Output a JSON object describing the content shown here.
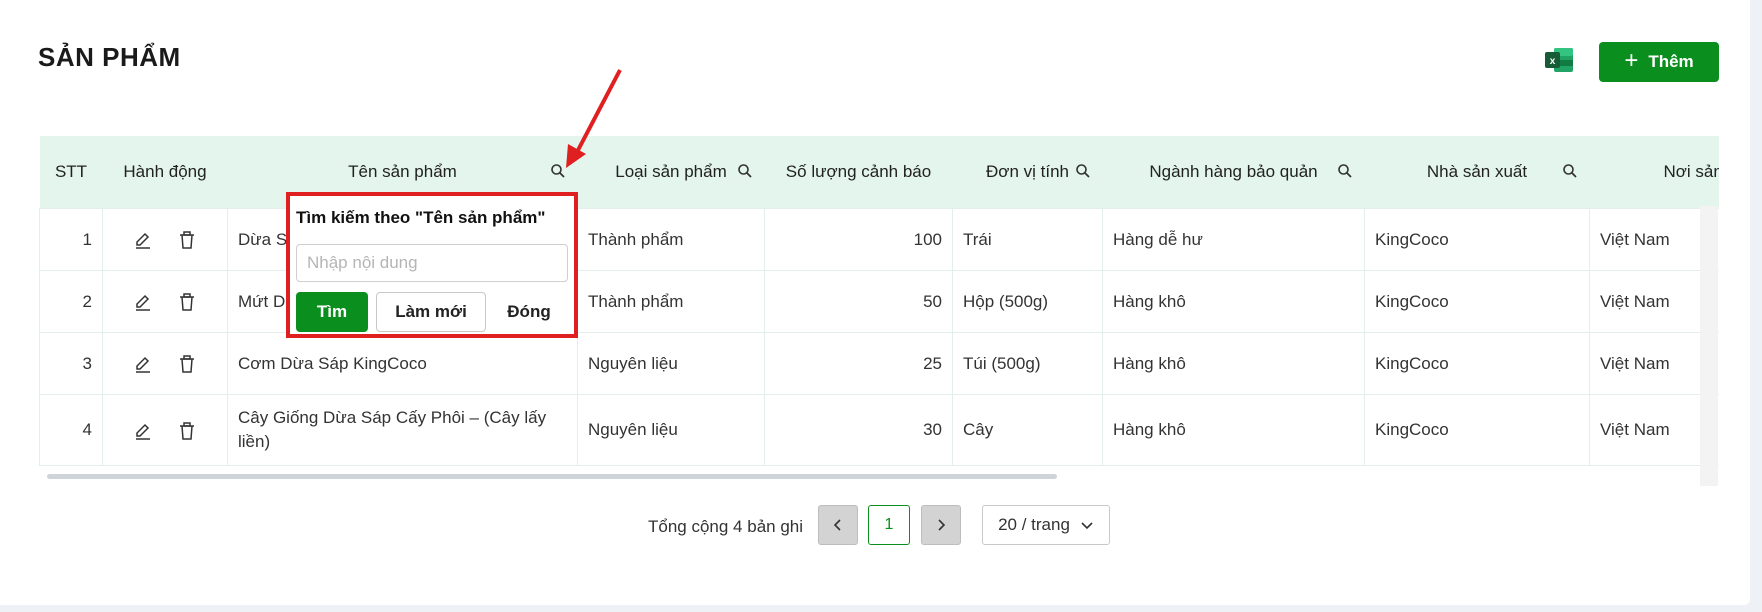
{
  "page": {
    "title": "SẢN PHẨM"
  },
  "toolbar": {
    "add_label": "Thêm",
    "excel_icon": "excel-icon"
  },
  "table": {
    "columns": [
      "STT",
      "Hành động",
      "Tên sản phẩm",
      "Loại sản phẩm",
      "Số lượng cảnh báo",
      "Đơn vị tính",
      "Ngành hàng bảo quản",
      "Nhà sản xuất",
      "Nơi sản xu"
    ],
    "rows": [
      {
        "stt": "1",
        "name": "Dừa S",
        "type": "Thành phẩm",
        "qty": "100",
        "unit": "Trái",
        "category": "Hàng dễ hư",
        "maker": "KingCoco",
        "origin": "Việt Nam"
      },
      {
        "stt": "2",
        "name": "Mứt D",
        "type": "Thành phẩm",
        "qty": "50",
        "unit": "Hộp (500g)",
        "category": "Hàng khô",
        "maker": "KingCoco",
        "origin": "Việt Nam"
      },
      {
        "stt": "3",
        "name": "Cơm Dừa Sáp KingCoco",
        "type": "Nguyên liệu",
        "qty": "25",
        "unit": "Túi (500g)",
        "category": "Hàng khô",
        "maker": "KingCoco",
        "origin": "Việt Nam"
      },
      {
        "stt": "4",
        "name": "Cây Giống Dừa Sáp Cấy Phôi – (Cây lấy liền)",
        "type": "Nguyên liệu",
        "qty": "30",
        "unit": "Cây",
        "category": "Hàng khô",
        "maker": "KingCoco",
        "origin": "Việt Nam"
      }
    ]
  },
  "search_popup": {
    "title": "Tìm kiếm theo \"Tên sản phẩm\"",
    "placeholder": "Nhập nội dung",
    "value": "",
    "find_label": "Tìm",
    "reset_label": "Làm mới",
    "close_label": "Đóng"
  },
  "pagination": {
    "total_text": "Tổng cộng 4 bản ghi",
    "current_page": "1",
    "page_size": "20 / trang"
  },
  "colors": {
    "accent": "#0a8f1e",
    "header_bg": "#e3f5ec",
    "highlight": "#e02020"
  }
}
